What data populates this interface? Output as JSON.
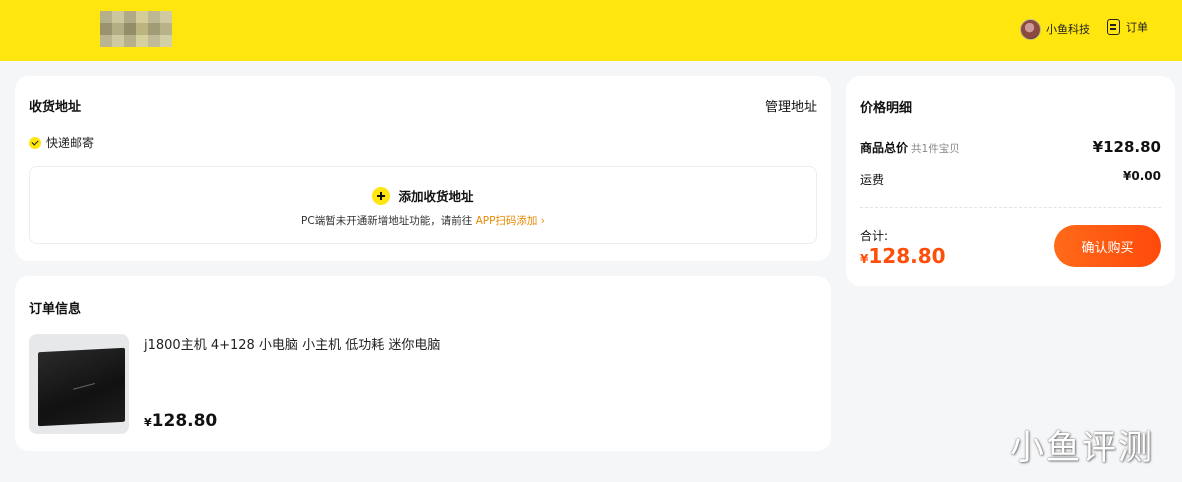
{
  "header": {
    "user_name": "小鱼科技",
    "orders_label": "订单"
  },
  "address": {
    "title": "收货地址",
    "manage_label": "管理地址",
    "shipping_method": "快递邮寄",
    "add_label": "添加收货地址",
    "note_prefix": "PC端暂未开通新增地址功能，请前往 ",
    "note_link": "APP扫码添加 ›"
  },
  "order": {
    "title": "订单信息",
    "item_title": "j1800主机 4+128 小电脑 小主机 低功耗 迷你电脑",
    "currency": "¥",
    "item_price": "128.80"
  },
  "price": {
    "title": "价格明细",
    "goods_label": "商品总价",
    "goods_sub": "共1件宝贝",
    "goods_value": "¥128.80",
    "shipping_label": "运费",
    "shipping_value": "¥0.00",
    "total_label": "合计:",
    "currency": "¥",
    "total_value": "128.80",
    "buy_label": "确认购买"
  },
  "watermark": "小鱼评测",
  "colors": {
    "brand_yellow": "#ffe60f",
    "accent_orange": "#ff4d0a",
    "link_orange": "#e88a00"
  }
}
